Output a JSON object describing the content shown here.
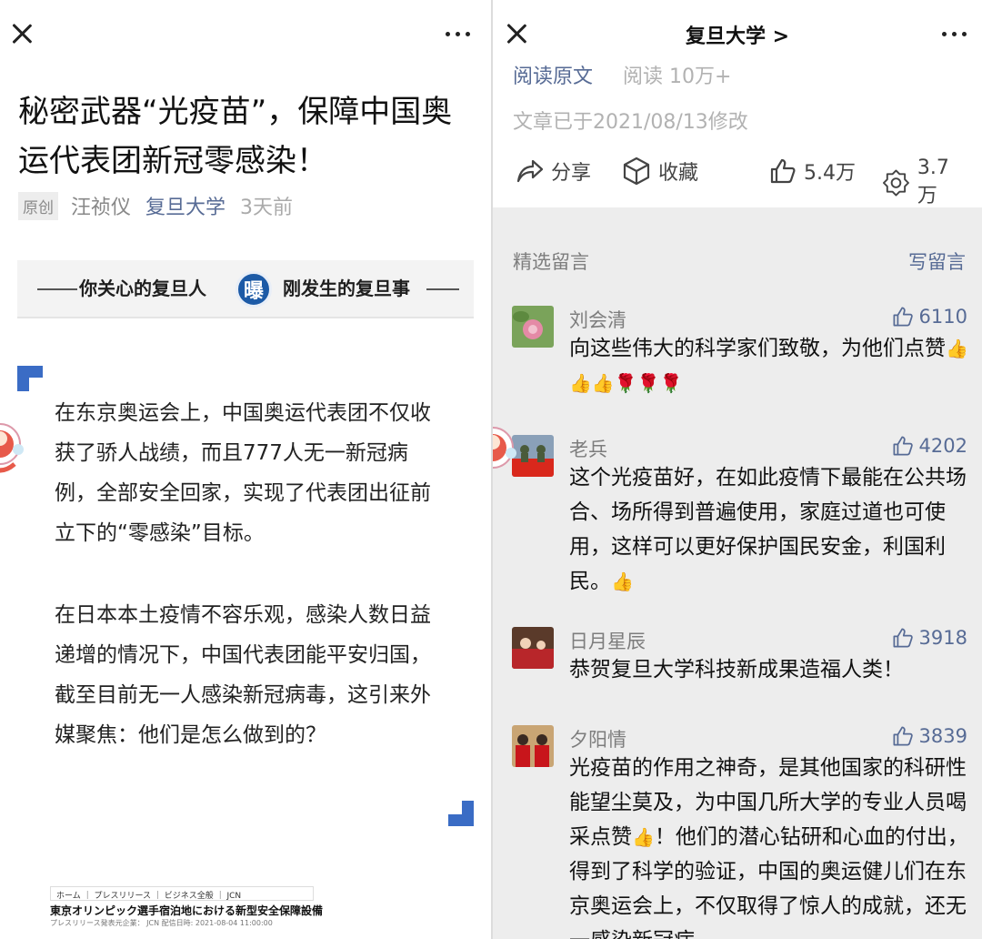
{
  "left": {
    "article": {
      "title": "秘密武器“光疫苗”，保障中国奥运代表团新冠零感染！",
      "original_tag": "原创",
      "author": "汪祯仪",
      "account": "复旦大学",
      "time": "3天前"
    },
    "banner": {
      "left_text": "你关心的复旦人",
      "logo_char": "曝",
      "right_text": "刚发生的复旦事"
    },
    "paragraphs": [
      "在东京奥运会上，中国奥运代表团不仅收获了骄人战绩，而且777人无一新冠病例，全部安全回家，实现了代表团出征前立下的“零感染”目标。",
      "在日本本土疫情不容乐观，感染人数日益递增的情况下，中国代表团能平安归国，截至目前无一人感染新冠病毒，这引来外媒聚焦：他们是怎么做到的？"
    ],
    "news_image": {
      "breadcrumb": "ホーム ｜ プレスリリース ｜ ビジネス全般 ｜ JCN",
      "title": "東京オリンピック選手宿泊地における新型安全保障設備",
      "sub": "プレスリリース発表元企業： JCN   配信日時: 2021-08-04 11:00:00"
    }
  },
  "right": {
    "header_title": "复旦大学 >",
    "read_original": "阅读原文",
    "reads": "阅读 10万+",
    "modified": "文章已于2021/08/13修改",
    "actions": {
      "share": "分享",
      "favorite": "收藏",
      "likes": "5.4万",
      "wow": "3.7万"
    },
    "comments_header": "精选留言",
    "write_comment": "写留言",
    "comments": [
      {
        "name": "刘会清",
        "likes": "6110",
        "text": "向这些伟大的科学家们致敬，为他们点赞",
        "emoji": "👍👍👍🌹🌹🌹"
      },
      {
        "name": "老兵",
        "likes": "4202",
        "text": "这个光疫苗好，在如此疫情下最能在公共场合、场所得到普遍使用，家庭过道也可使用，这样可以更好保护国民安金，利国利民。",
        "emoji": "👍"
      },
      {
        "name": "日月星辰",
        "likes": "3918",
        "text": "恭贺复旦大学科技新成果造福人类！",
        "emoji": ""
      },
      {
        "name": "夕阳情",
        "likes": "3839",
        "text_a": "光疫苗的作用之神奇，是其他国家的科研性能望尘莫及，为中国几所大学的专业人员喝采点赞",
        "emoji": "👍",
        "text_b": "！他们的潜心钻研和心血的付出，得到了科学的验证，中国的奥运健儿们在东京奥运会上，不仅取得了惊人的成就，还无一感染新冠病"
      }
    ]
  },
  "colors": {
    "link_blue": "#576b95",
    "accent_blue": "#3a6cc5",
    "muted_gray": "#b2b2b2"
  },
  "icons": [
    "close-icon",
    "more-icon",
    "share-icon",
    "favorite-icon",
    "like-icon",
    "wow-icon"
  ]
}
